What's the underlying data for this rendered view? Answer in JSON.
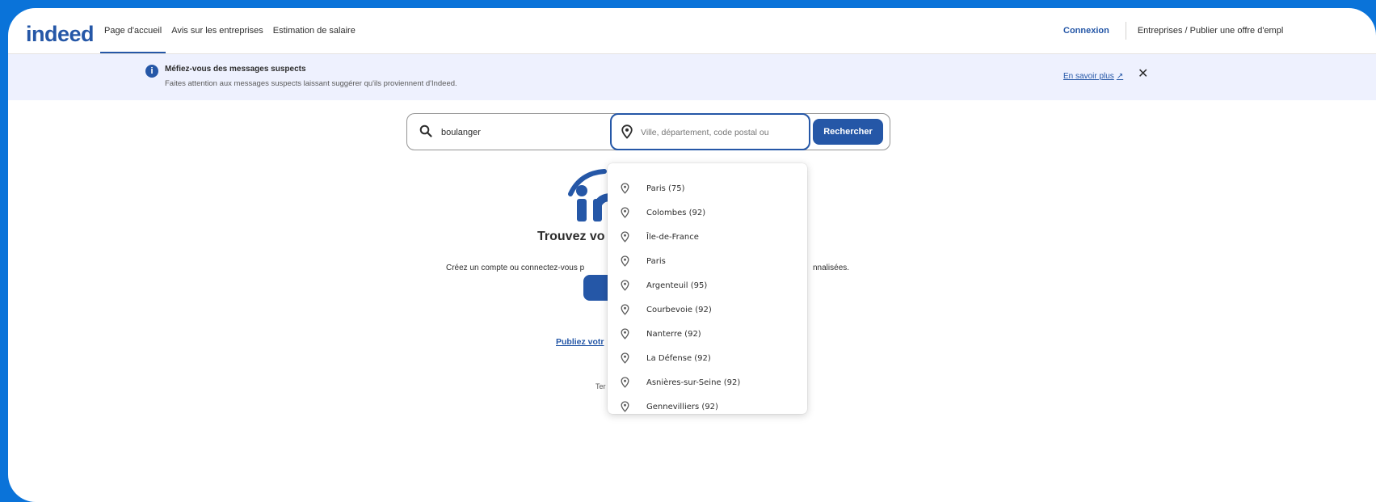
{
  "header": {
    "logo": "indeed",
    "nav": [
      {
        "label": "Page d'accueil"
      },
      {
        "label": "Avis sur les entreprises"
      },
      {
        "label": "Estimation de salaire"
      }
    ],
    "signin_label": "Connexion",
    "employers_label": "Entreprises / Publier une offre d'empl"
  },
  "banner": {
    "title": "Méfiez-vous des messages suspects",
    "text": "Faites attention aux messages suspects laissant suggérer qu'ils proviennent d'Indeed.",
    "learn_more": "En savoir plus"
  },
  "search": {
    "what_value": "boulanger",
    "where_placeholder": "Ville, département, code postal ou",
    "button_label": "Rechercher"
  },
  "hero": {
    "title_visible": "Trouvez vo",
    "subtitle_left": "Créez un compte ou connectez-vous p",
    "subtitle_right": "nnalisées.",
    "publish_visible": "Publiez votr",
    "terms_visible": "Ter"
  },
  "suggestions": [
    {
      "label": "Paris (75)"
    },
    {
      "label": "Colombes (92)"
    },
    {
      "label": "Île-de-France"
    },
    {
      "label": "Paris"
    },
    {
      "label": "Argenteuil (95)"
    },
    {
      "label": "Courbevoie (92)"
    },
    {
      "label": "Nanterre (92)"
    },
    {
      "label": "La Défense (92)"
    },
    {
      "label": "Asnières-sur-Seine (92)"
    },
    {
      "label": "Gennevilliers (92)"
    }
  ],
  "colors": {
    "brand": "#2557a7",
    "outer_background": "#0a73d9",
    "banner_background": "#eef1fe"
  }
}
